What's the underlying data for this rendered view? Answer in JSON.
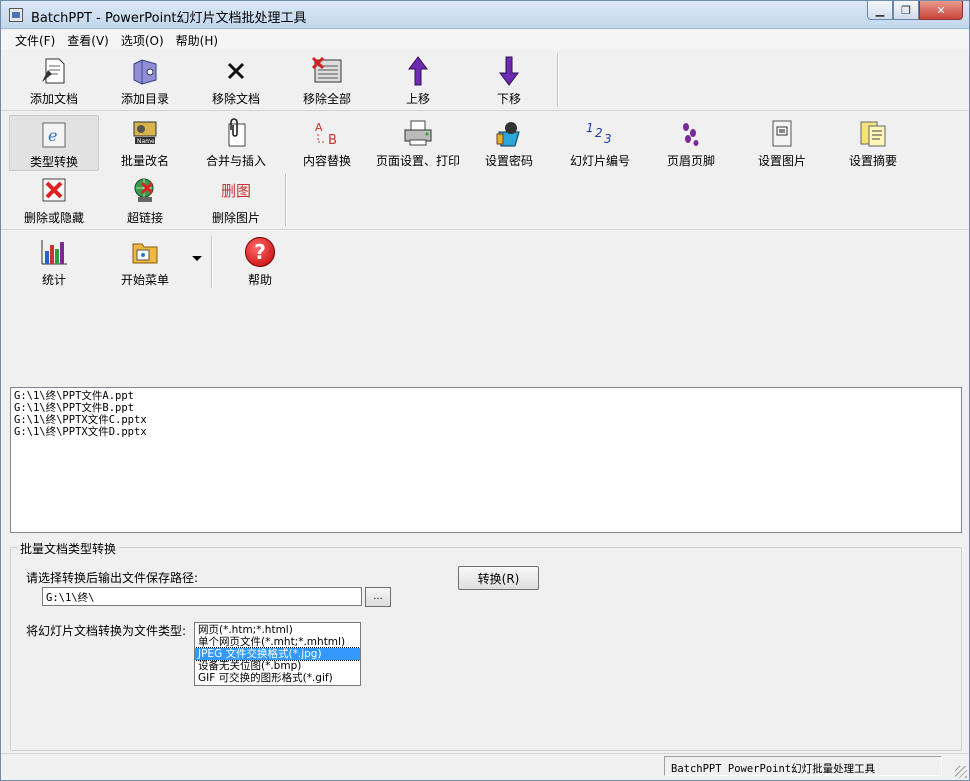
{
  "window": {
    "title": "BatchPPT - PowerPoint幻灯片文档批处理工具",
    "minimize": "▁",
    "restore": "❐",
    "close": "✕"
  },
  "menu": [
    "文件(F)",
    "查看(V)",
    "选项(O)",
    "帮助(H)"
  ],
  "toolbar1": [
    {
      "label": "添加文档",
      "icon": "add-document-icon"
    },
    {
      "label": "添加目录",
      "icon": "add-folder-icon"
    },
    {
      "label": "移除文档",
      "icon": "remove-icon"
    },
    {
      "label": "移除全部",
      "icon": "remove-all-icon"
    },
    {
      "label": "上移",
      "icon": "arrow-up-icon"
    },
    {
      "label": "下移",
      "icon": "arrow-down-icon"
    }
  ],
  "toolbar2": [
    {
      "label": "类型转换",
      "icon": "convert-type-icon"
    },
    {
      "label": "批量改名",
      "icon": "rename-icon"
    },
    {
      "label": "合并与插入",
      "icon": "paperclip-icon"
    },
    {
      "label": "内容替换",
      "icon": "replace-icon"
    },
    {
      "label": "页面设置、打印",
      "icon": "printer-icon"
    },
    {
      "label": "设置密码",
      "icon": "password-icon"
    },
    {
      "label": "幻灯片编号",
      "icon": "numbering-icon"
    },
    {
      "label": "页眉页脚",
      "icon": "footprints-icon"
    },
    {
      "label": "设置图片",
      "icon": "picture-icon"
    },
    {
      "label": "设置摘要",
      "icon": "summary-icon"
    }
  ],
  "toolbar3": [
    {
      "label": "删除或隐藏",
      "icon": "delete-hide-icon"
    },
    {
      "label": "超链接",
      "icon": "hyperlink-icon"
    },
    {
      "label": "删除图片",
      "icon": "delete-picture-icon",
      "icon_text": "删图"
    }
  ],
  "toolbar4": [
    {
      "label": "统计",
      "icon": "statistics-icon"
    },
    {
      "label": "开始菜单",
      "icon": "start-menu-icon"
    },
    {
      "label": "帮助",
      "icon": "help-icon",
      "icon_text": "?"
    }
  ],
  "files": [
    "G:\\1\\终\\PPT文件A.ppt",
    "G:\\1\\终\\PPT文件B.ppt",
    "G:\\1\\终\\PPTX文件C.pptx",
    "G:\\1\\终\\PPTX文件D.pptx"
  ],
  "panel": {
    "title": "批量文档类型转换",
    "path_label": "请选择转换后输出文件保存路径:",
    "path_value": "G:\\1\\终\\",
    "browse": "...",
    "convert": "转换(R)",
    "type_label": "将幻灯片文档转换为文件类型:",
    "types": [
      "网页(*.htm;*.html)",
      "单个网页文件(*.mht;*.mhtml)",
      "JPEG 文件交换格式(*.jpg)",
      "设备无关位图(*.bmp)",
      "GIF 可交换的图形格式(*.gif)"
    ],
    "selected_type": "JPEG 文件交换格式(*.jpg)"
  },
  "status": "BatchPPT PowerPoint幻灯批量处理工具"
}
